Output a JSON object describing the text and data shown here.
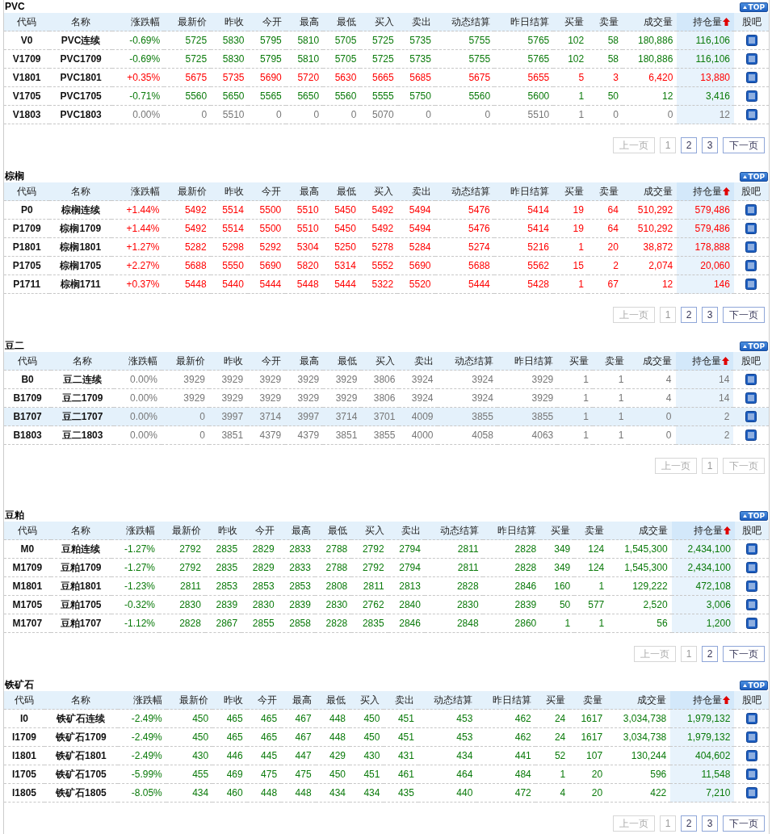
{
  "sections": [
    {
      "title": "PVC",
      "top_button": "TOP",
      "columns": [
        {
          "label": "代码",
          "sorted": false
        },
        {
          "label": "名称",
          "sorted": false
        },
        {
          "label": "涨跌幅",
          "sorted": false
        },
        {
          "label": "最新价",
          "sorted": false
        },
        {
          "label": "昨收",
          "sorted": false
        },
        {
          "label": "今开",
          "sorted": false
        },
        {
          "label": "最高",
          "sorted": false
        },
        {
          "label": "最低",
          "sorted": false
        },
        {
          "label": "买入",
          "sorted": false
        },
        {
          "label": "卖出",
          "sorted": false
        },
        {
          "label": "动态结算",
          "sorted": false
        },
        {
          "label": "昨日结算",
          "sorted": false
        },
        {
          "label": "买量",
          "sorted": false
        },
        {
          "label": "卖量",
          "sorted": false
        },
        {
          "label": "成交量",
          "sorted": false
        },
        {
          "label": "持仓量",
          "sorted": true
        },
        {
          "label": "股吧",
          "sorted": false
        }
      ],
      "rows": [
        {
          "kind": "down",
          "selected": false,
          "cells": [
            "V0",
            "PVC连续",
            "-0.69%",
            "5725",
            "5830",
            "5795",
            "5810",
            "5705",
            "5725",
            "5735",
            "5755",
            "5765",
            "102",
            "58",
            "180,886",
            "116,106"
          ]
        },
        {
          "kind": "down",
          "selected": false,
          "cells": [
            "V1709",
            "PVC1709",
            "-0.69%",
            "5725",
            "5830",
            "5795",
            "5810",
            "5705",
            "5725",
            "5735",
            "5755",
            "5765",
            "102",
            "58",
            "180,886",
            "116,106"
          ]
        },
        {
          "kind": "up",
          "selected": false,
          "cells": [
            "V1801",
            "PVC1801",
            "+0.35%",
            "5675",
            "5735",
            "5690",
            "5720",
            "5630",
            "5665",
            "5685",
            "5675",
            "5655",
            "5",
            "3",
            "6,420",
            "13,880"
          ]
        },
        {
          "kind": "down",
          "selected": false,
          "cells": [
            "V1705",
            "PVC1705",
            "-0.71%",
            "5560",
            "5650",
            "5565",
            "5650",
            "5560",
            "5555",
            "5750",
            "5560",
            "5600",
            "1",
            "50",
            "12",
            "3,416"
          ]
        },
        {
          "kind": "flat",
          "selected": false,
          "cells": [
            "V1803",
            "PVC1803",
            "0.00%",
            "0",
            "5510",
            "0",
            "0",
            "0",
            "5070",
            "0",
            "0",
            "5510",
            "1",
            "0",
            "0",
            "12"
          ]
        }
      ],
      "pager": [
        {
          "label": "上一页",
          "kind": "prev",
          "disabled": true,
          "selected": false
        },
        {
          "label": "1",
          "kind": "page",
          "disabled": false,
          "selected": true
        },
        {
          "label": "2",
          "kind": "page",
          "disabled": false,
          "selected": false
        },
        {
          "label": "3",
          "kind": "page",
          "disabled": false,
          "selected": false
        },
        {
          "label": "下一页",
          "kind": "next",
          "disabled": false,
          "selected": false
        }
      ]
    },
    {
      "title": "棕榈",
      "top_button": "TOP",
      "columns": [
        {
          "label": "代码",
          "sorted": false
        },
        {
          "label": "名称",
          "sorted": false
        },
        {
          "label": "涨跌幅",
          "sorted": false
        },
        {
          "label": "最新价",
          "sorted": false
        },
        {
          "label": "昨收",
          "sorted": false
        },
        {
          "label": "今开",
          "sorted": false
        },
        {
          "label": "最高",
          "sorted": false
        },
        {
          "label": "最低",
          "sorted": false
        },
        {
          "label": "买入",
          "sorted": false
        },
        {
          "label": "卖出",
          "sorted": false
        },
        {
          "label": "动态结算",
          "sorted": false
        },
        {
          "label": "昨日结算",
          "sorted": false
        },
        {
          "label": "买量",
          "sorted": false
        },
        {
          "label": "卖量",
          "sorted": false
        },
        {
          "label": "成交量",
          "sorted": false
        },
        {
          "label": "持仓量",
          "sorted": true
        },
        {
          "label": "股吧",
          "sorted": false
        }
      ],
      "rows": [
        {
          "kind": "up",
          "selected": false,
          "cells": [
            "P0",
            "棕榈连续",
            "+1.44%",
            "5492",
            "5514",
            "5500",
            "5510",
            "5450",
            "5492",
            "5494",
            "5476",
            "5414",
            "19",
            "64",
            "510,292",
            "579,486"
          ]
        },
        {
          "kind": "up",
          "selected": false,
          "cells": [
            "P1709",
            "棕榈1709",
            "+1.44%",
            "5492",
            "5514",
            "5500",
            "5510",
            "5450",
            "5492",
            "5494",
            "5476",
            "5414",
            "19",
            "64",
            "510,292",
            "579,486"
          ]
        },
        {
          "kind": "up",
          "selected": false,
          "cells": [
            "P1801",
            "棕榈1801",
            "+1.27%",
            "5282",
            "5298",
            "5292",
            "5304",
            "5250",
            "5278",
            "5284",
            "5274",
            "5216",
            "1",
            "20",
            "38,872",
            "178,888"
          ]
        },
        {
          "kind": "up",
          "selected": false,
          "cells": [
            "P1705",
            "棕榈1705",
            "+2.27%",
            "5688",
            "5550",
            "5690",
            "5820",
            "5314",
            "5552",
            "5690",
            "5688",
            "5562",
            "15",
            "2",
            "2,074",
            "20,060"
          ]
        },
        {
          "kind": "up",
          "selected": false,
          "cells": [
            "P1711",
            "棕榈1711",
            "+0.37%",
            "5448",
            "5440",
            "5444",
            "5448",
            "5444",
            "5322",
            "5520",
            "5444",
            "5428",
            "1",
            "67",
            "12",
            "146"
          ]
        }
      ],
      "pager": [
        {
          "label": "上一页",
          "kind": "prev",
          "disabled": true,
          "selected": false
        },
        {
          "label": "1",
          "kind": "page",
          "disabled": false,
          "selected": true
        },
        {
          "label": "2",
          "kind": "page",
          "disabled": false,
          "selected": false
        },
        {
          "label": "3",
          "kind": "page",
          "disabled": false,
          "selected": false
        },
        {
          "label": "下一页",
          "kind": "next",
          "disabled": false,
          "selected": false
        }
      ]
    },
    {
      "title": "豆二",
      "top_button": "TOP",
      "columns": [
        {
          "label": "代码",
          "sorted": false
        },
        {
          "label": "名称",
          "sorted": false
        },
        {
          "label": "涨跌幅",
          "sorted": false
        },
        {
          "label": "最新价",
          "sorted": false
        },
        {
          "label": "昨收",
          "sorted": false
        },
        {
          "label": "今开",
          "sorted": false
        },
        {
          "label": "最高",
          "sorted": false
        },
        {
          "label": "最低",
          "sorted": false
        },
        {
          "label": "买入",
          "sorted": false
        },
        {
          "label": "卖出",
          "sorted": false
        },
        {
          "label": "动态结算",
          "sorted": false
        },
        {
          "label": "昨日结算",
          "sorted": false
        },
        {
          "label": "买量",
          "sorted": false
        },
        {
          "label": "卖量",
          "sorted": false
        },
        {
          "label": "成交量",
          "sorted": false
        },
        {
          "label": "持仓量",
          "sorted": true
        },
        {
          "label": "股吧",
          "sorted": false
        }
      ],
      "rows": [
        {
          "kind": "flat",
          "selected": false,
          "cells": [
            "B0",
            "豆二连续",
            "0.00%",
            "3929",
            "3929",
            "3929",
            "3929",
            "3929",
            "3806",
            "3924",
            "3924",
            "3929",
            "1",
            "1",
            "4",
            "14"
          ]
        },
        {
          "kind": "flat",
          "selected": false,
          "cells": [
            "B1709",
            "豆二1709",
            "0.00%",
            "3929",
            "3929",
            "3929",
            "3929",
            "3929",
            "3806",
            "3924",
            "3924",
            "3929",
            "1",
            "1",
            "4",
            "14"
          ]
        },
        {
          "kind": "flat",
          "selected": true,
          "cells": [
            "B1707",
            "豆二1707",
            "0.00%",
            "0",
            "3997",
            "3714",
            "3997",
            "3714",
            "3701",
            "4009",
            "3855",
            "3855",
            "1",
            "1",
            "0",
            "2"
          ]
        },
        {
          "kind": "flat",
          "selected": false,
          "cells": [
            "B1803",
            "豆二1803",
            "0.00%",
            "0",
            "3851",
            "4379",
            "4379",
            "3851",
            "3855",
            "4000",
            "4058",
            "4063",
            "1",
            "1",
            "0",
            "2"
          ]
        }
      ],
      "pager": [
        {
          "label": "上一页",
          "kind": "prev",
          "disabled": true,
          "selected": false
        },
        {
          "label": "1",
          "kind": "page",
          "disabled": false,
          "selected": true
        },
        {
          "label": "下一页",
          "kind": "next",
          "disabled": true,
          "selected": false
        }
      ]
    },
    {
      "title": "豆粕",
      "top_button": "TOP",
      "columns": [
        {
          "label": "代码",
          "sorted": false
        },
        {
          "label": "名称",
          "sorted": false
        },
        {
          "label": "涨跌幅",
          "sorted": false
        },
        {
          "label": "最新价",
          "sorted": false
        },
        {
          "label": "昨收",
          "sorted": false
        },
        {
          "label": "今开",
          "sorted": false
        },
        {
          "label": "最高",
          "sorted": false
        },
        {
          "label": "最低",
          "sorted": false
        },
        {
          "label": "买入",
          "sorted": false
        },
        {
          "label": "卖出",
          "sorted": false
        },
        {
          "label": "动态结算",
          "sorted": false
        },
        {
          "label": "昨日结算",
          "sorted": false
        },
        {
          "label": "买量",
          "sorted": false
        },
        {
          "label": "卖量",
          "sorted": false
        },
        {
          "label": "成交量",
          "sorted": false
        },
        {
          "label": "持仓量",
          "sorted": true
        },
        {
          "label": "股吧",
          "sorted": false
        }
      ],
      "rows": [
        {
          "kind": "down",
          "selected": false,
          "cells": [
            "M0",
            "豆粕连续",
            "-1.27%",
            "2792",
            "2835",
            "2829",
            "2833",
            "2788",
            "2792",
            "2794",
            "2811",
            "2828",
            "349",
            "124",
            "1,545,300",
            "2,434,100"
          ]
        },
        {
          "kind": "down",
          "selected": false,
          "cells": [
            "M1709",
            "豆粕1709",
            "-1.27%",
            "2792",
            "2835",
            "2829",
            "2833",
            "2788",
            "2792",
            "2794",
            "2811",
            "2828",
            "349",
            "124",
            "1,545,300",
            "2,434,100"
          ]
        },
        {
          "kind": "down",
          "selected": false,
          "cells": [
            "M1801",
            "豆粕1801",
            "-1.23%",
            "2811",
            "2853",
            "2853",
            "2853",
            "2808",
            "2811",
            "2813",
            "2828",
            "2846",
            "160",
            "1",
            "129,222",
            "472,108"
          ]
        },
        {
          "kind": "down",
          "selected": false,
          "cells": [
            "M1705",
            "豆粕1705",
            "-0.32%",
            "2830",
            "2839",
            "2830",
            "2839",
            "2830",
            "2762",
            "2840",
            "2830",
            "2839",
            "50",
            "577",
            "2,520",
            "3,006"
          ]
        },
        {
          "kind": "down",
          "selected": false,
          "cells": [
            "M1707",
            "豆粕1707",
            "-1.12%",
            "2828",
            "2867",
            "2855",
            "2858",
            "2828",
            "2835",
            "2846",
            "2848",
            "2860",
            "1",
            "1",
            "56",
            "1,200"
          ]
        }
      ],
      "pager": [
        {
          "label": "上一页",
          "kind": "prev",
          "disabled": true,
          "selected": false
        },
        {
          "label": "1",
          "kind": "page",
          "disabled": false,
          "selected": true
        },
        {
          "label": "2",
          "kind": "page",
          "disabled": false,
          "selected": false
        },
        {
          "label": "下一页",
          "kind": "next",
          "disabled": false,
          "selected": false
        }
      ]
    },
    {
      "title": "铁矿石",
      "top_button": "TOP",
      "columns": [
        {
          "label": "代码",
          "sorted": false
        },
        {
          "label": "名称",
          "sorted": false
        },
        {
          "label": "涨跌幅",
          "sorted": false
        },
        {
          "label": "最新价",
          "sorted": false
        },
        {
          "label": "昨收",
          "sorted": false
        },
        {
          "label": "今开",
          "sorted": false
        },
        {
          "label": "最高",
          "sorted": false
        },
        {
          "label": "最低",
          "sorted": false
        },
        {
          "label": "买入",
          "sorted": false
        },
        {
          "label": "卖出",
          "sorted": false
        },
        {
          "label": "动态结算",
          "sorted": false
        },
        {
          "label": "昨日结算",
          "sorted": false
        },
        {
          "label": "买量",
          "sorted": false
        },
        {
          "label": "卖量",
          "sorted": false
        },
        {
          "label": "成交量",
          "sorted": false
        },
        {
          "label": "持仓量",
          "sorted": true
        },
        {
          "label": "股吧",
          "sorted": false
        }
      ],
      "rows": [
        {
          "kind": "down",
          "selected": false,
          "cells": [
            "I0",
            "铁矿石连续",
            "-2.49%",
            "450",
            "465",
            "465",
            "467",
            "448",
            "450",
            "451",
            "453",
            "462",
            "24",
            "1617",
            "3,034,738",
            "1,979,132"
          ]
        },
        {
          "kind": "down",
          "selected": false,
          "cells": [
            "I1709",
            "铁矿石1709",
            "-2.49%",
            "450",
            "465",
            "465",
            "467",
            "448",
            "450",
            "451",
            "453",
            "462",
            "24",
            "1617",
            "3,034,738",
            "1,979,132"
          ]
        },
        {
          "kind": "down",
          "selected": false,
          "cells": [
            "I1801",
            "铁矿石1801",
            "-2.49%",
            "430",
            "446",
            "445",
            "447",
            "429",
            "430",
            "431",
            "434",
            "441",
            "52",
            "107",
            "130,244",
            "404,602"
          ]
        },
        {
          "kind": "down",
          "selected": false,
          "cells": [
            "I1705",
            "铁矿石1705",
            "-5.99%",
            "455",
            "469",
            "475",
            "475",
            "450",
            "451",
            "461",
            "464",
            "484",
            "1",
            "20",
            "596",
            "11,548"
          ]
        },
        {
          "kind": "down",
          "selected": false,
          "cells": [
            "I1805",
            "铁矿石1805",
            "-8.05%",
            "434",
            "460",
            "448",
            "448",
            "434",
            "434",
            "435",
            "440",
            "472",
            "4",
            "20",
            "422",
            "7,210"
          ]
        }
      ],
      "pager": [
        {
          "label": "上一页",
          "kind": "prev",
          "disabled": true,
          "selected": false
        },
        {
          "label": "1",
          "kind": "page",
          "disabled": false,
          "selected": true
        },
        {
          "label": "2",
          "kind": "page",
          "disabled": false,
          "selected": false
        },
        {
          "label": "3",
          "kind": "page",
          "disabled": false,
          "selected": false
        },
        {
          "label": "下一页",
          "kind": "next",
          "disabled": false,
          "selected": false
        }
      ]
    }
  ]
}
